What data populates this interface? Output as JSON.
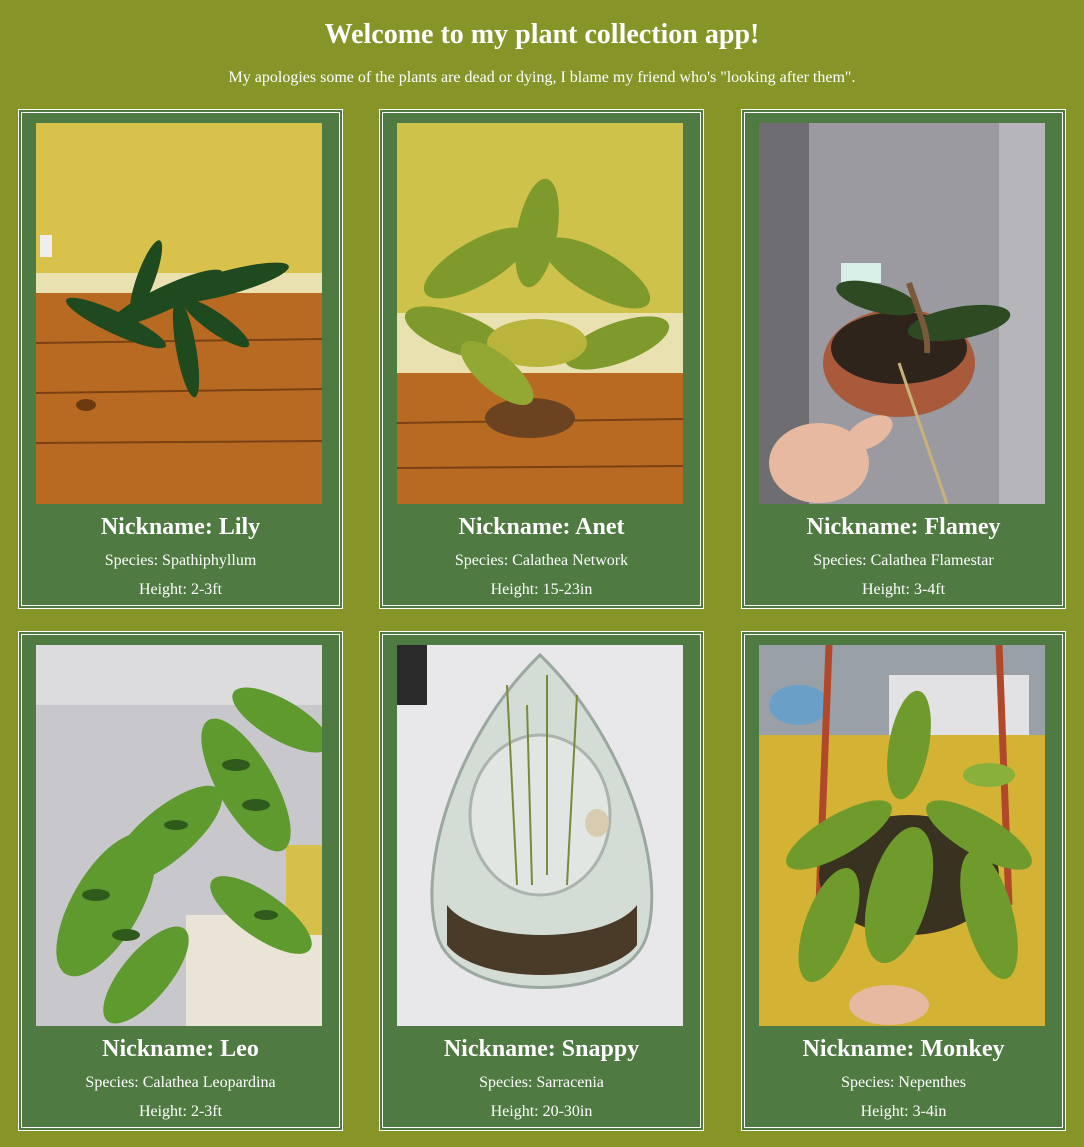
{
  "header": {
    "title": "Welcome to my plant collection app!",
    "subtitle": "My apologies some of the plants are dead or dying, I blame my friend who's \"looking after them\"."
  },
  "plants": [
    {
      "nickname": "Nickname: Lily",
      "species": "Species: Spathiphyllum",
      "height": "Height: 2-3ft"
    },
    {
      "nickname": "Nickname: Anet",
      "species": "Species: Calathea Network",
      "height": "Height: 15-23in"
    },
    {
      "nickname": "Nickname: Flamey",
      "species": "Species: Calathea Flamestar",
      "height": "Height: 3-4ft"
    },
    {
      "nickname": "Nickname: Leo",
      "species": "Species: Calathea Leopardina",
      "height": "Height: 2-3ft"
    },
    {
      "nickname": "Nickname: Snappy",
      "species": "Species: Sarracenia",
      "height": "Height: 20-30in"
    },
    {
      "nickname": "Nickname: Monkey",
      "species": "Species: Nepenthes",
      "height": "Height: 3-4in"
    }
  ],
  "colors": {
    "page_background": "#879428",
    "card_background": "#4f7a41",
    "text": "#ffffff",
    "border": "#ffffff"
  }
}
